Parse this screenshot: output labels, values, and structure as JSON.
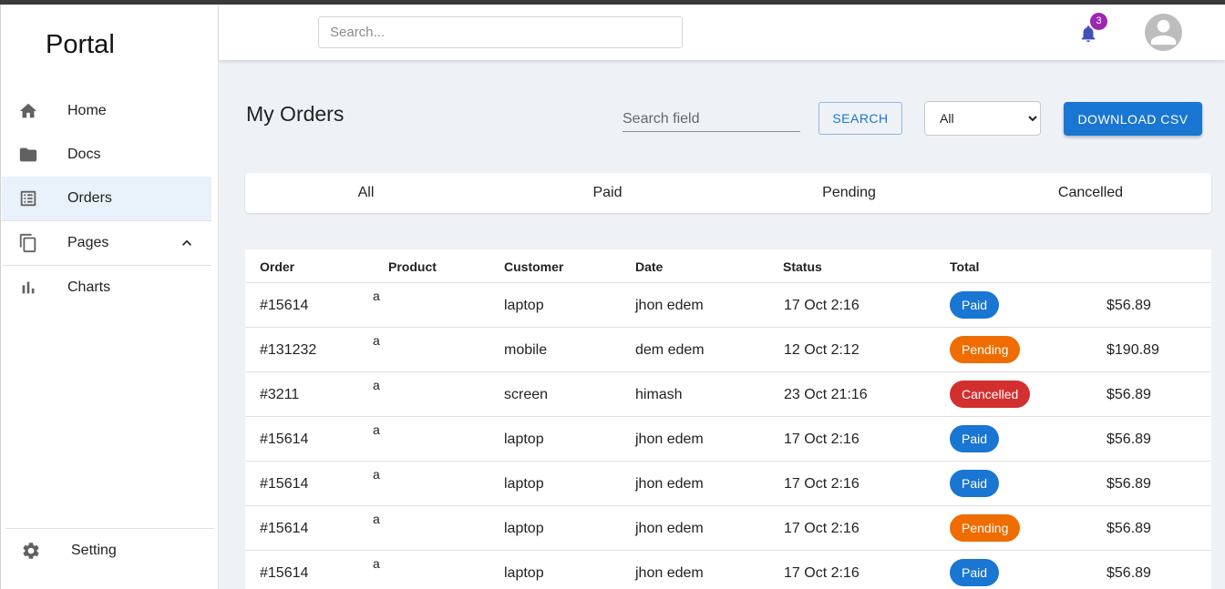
{
  "sidebar": {
    "brand": "Portal",
    "items": [
      {
        "label": "Home",
        "icon": "home-icon"
      },
      {
        "label": "Docs",
        "icon": "folder-icon"
      },
      {
        "label": "Orders",
        "icon": "list-icon",
        "active": true
      },
      {
        "label": "Pages",
        "icon": "copy-icon",
        "expanded": true
      },
      {
        "label": "Charts",
        "icon": "bar-chart-icon"
      }
    ],
    "setting_label": "Setting"
  },
  "header": {
    "search_placeholder": "Search...",
    "notification_count": "3"
  },
  "main": {
    "title": "My Orders",
    "search_field_placeholder": "Search field",
    "search_button": "SEARCH",
    "filter_selected": "All",
    "download_button": "DOWNLOAD CSV",
    "tabs": [
      "All",
      "Paid",
      "Pending",
      "Cancelled"
    ]
  },
  "table": {
    "headers": [
      "Order",
      "Product",
      "Customer",
      "Date",
      "Status",
      "Total"
    ],
    "rows": [
      {
        "order": "#15614",
        "product": "a",
        "customer": "laptop",
        "date": "jhon edem",
        "time": "17 Oct 2:16",
        "status": "Paid",
        "total": "$56.89"
      },
      {
        "order": "#131232",
        "product": "a",
        "customer": "mobile",
        "date": "dem edem",
        "time": "12 Oct 2:12",
        "status": "Pending",
        "total": "$190.89"
      },
      {
        "order": "#3211",
        "product": "a",
        "customer": "screen",
        "date": "himash",
        "time": "23 Oct 21:16",
        "status": "Cancelled",
        "total": "$56.89"
      },
      {
        "order": "#15614",
        "product": "a",
        "customer": "laptop",
        "date": "jhon edem",
        "time": "17 Oct 2:16",
        "status": "Paid",
        "total": "$56.89"
      },
      {
        "order": "#15614",
        "product": "a",
        "customer": "laptop",
        "date": "jhon edem",
        "time": "17 Oct 2:16",
        "status": "Paid",
        "total": "$56.89"
      },
      {
        "order": "#15614",
        "product": "a",
        "customer": "laptop",
        "date": "jhon edem",
        "time": "17 Oct 2:16",
        "status": "Pending",
        "total": "$56.89"
      },
      {
        "order": "#15614",
        "product": "a",
        "customer": "laptop",
        "date": "jhon edem",
        "time": "17 Oct 2:16",
        "status": "Paid",
        "total": "$56.89"
      }
    ]
  },
  "colors": {
    "accent": "#1976d2",
    "paid": "#1976d2",
    "pending": "#ef6c00",
    "cancelled": "#d32f2f",
    "badge": "#9c27b0",
    "active_nav_bg": "#e9f1fb",
    "main_bg": "#eef2f7"
  }
}
